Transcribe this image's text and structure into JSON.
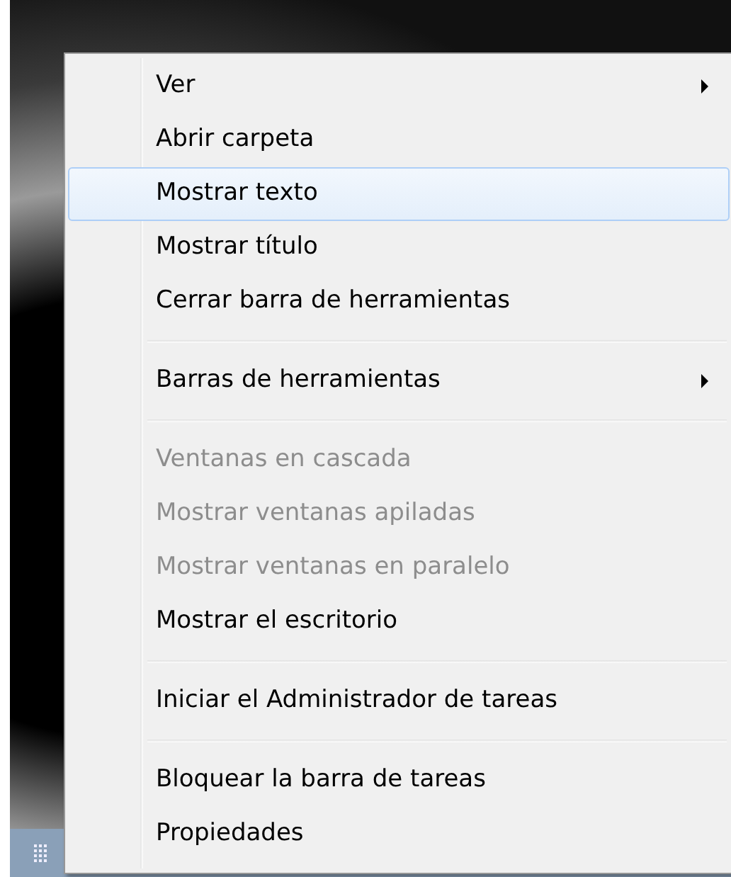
{
  "context_menu": {
    "items": [
      {
        "kind": "item",
        "label": "Ver",
        "submenu": true,
        "disabled": false,
        "selected": false
      },
      {
        "kind": "item",
        "label": "Abrir carpeta",
        "submenu": false,
        "disabled": false,
        "selected": false
      },
      {
        "kind": "item",
        "label": "Mostrar texto",
        "submenu": false,
        "disabled": false,
        "selected": true
      },
      {
        "kind": "item",
        "label": "Mostrar título",
        "submenu": false,
        "disabled": false,
        "selected": false
      },
      {
        "kind": "item",
        "label": "Cerrar barra de herramientas",
        "submenu": false,
        "disabled": false,
        "selected": false
      },
      {
        "kind": "separator"
      },
      {
        "kind": "item",
        "label": "Barras de herramientas",
        "submenu": true,
        "disabled": false,
        "selected": false
      },
      {
        "kind": "separator"
      },
      {
        "kind": "item",
        "label": "Ventanas en cascada",
        "submenu": false,
        "disabled": true,
        "selected": false
      },
      {
        "kind": "item",
        "label": "Mostrar ventanas apiladas",
        "submenu": false,
        "disabled": true,
        "selected": false
      },
      {
        "kind": "item",
        "label": "Mostrar ventanas en paralelo",
        "submenu": false,
        "disabled": true,
        "selected": false
      },
      {
        "kind": "item",
        "label": "Mostrar el escritorio",
        "submenu": false,
        "disabled": false,
        "selected": false
      },
      {
        "kind": "separator"
      },
      {
        "kind": "item",
        "label": "Iniciar el Administrador de tareas",
        "submenu": false,
        "disabled": false,
        "selected": false
      },
      {
        "kind": "separator"
      },
      {
        "kind": "item",
        "label": "Bloquear la barra de tareas",
        "submenu": false,
        "disabled": false,
        "selected": false
      },
      {
        "kind": "item",
        "label": "Propiedades",
        "submenu": false,
        "disabled": false,
        "selected": false
      }
    ]
  }
}
